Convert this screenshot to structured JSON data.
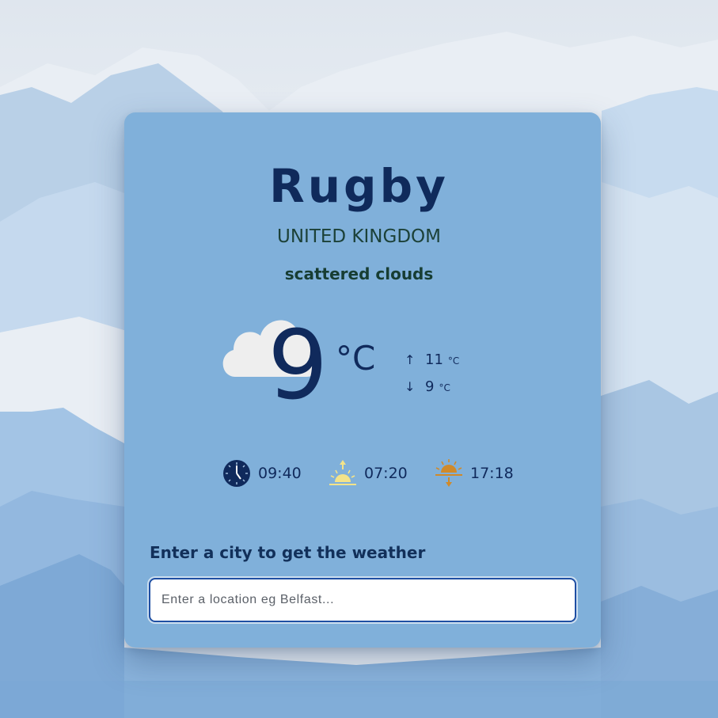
{
  "weather": {
    "city": "Rugby",
    "country": "UNITED KINGDOM",
    "description": "scattered clouds",
    "temperature": "9",
    "temperature_unit": "°C",
    "high": "11",
    "low": "9",
    "unit_small": "°C",
    "high_arrow": "↑",
    "low_arrow": "↓",
    "condition_icon": "cloud-icon"
  },
  "times": {
    "local_time": "09:40",
    "sunrise": "07:20",
    "sunset": "17:18",
    "icons": [
      "clock-icon",
      "sunrise-icon",
      "sunset-icon"
    ]
  },
  "search": {
    "prompt": "Enter a city to get the weather",
    "placeholder": "Enter a location eg Belfast...",
    "value": ""
  },
  "colors": {
    "card": "#80b0da",
    "primary_text": "#0f2a5b",
    "secondary_text": "#1c4138",
    "input_border": "#1f4fa3",
    "sunrise": "#f3e38a",
    "sunset": "#d08a2a"
  }
}
